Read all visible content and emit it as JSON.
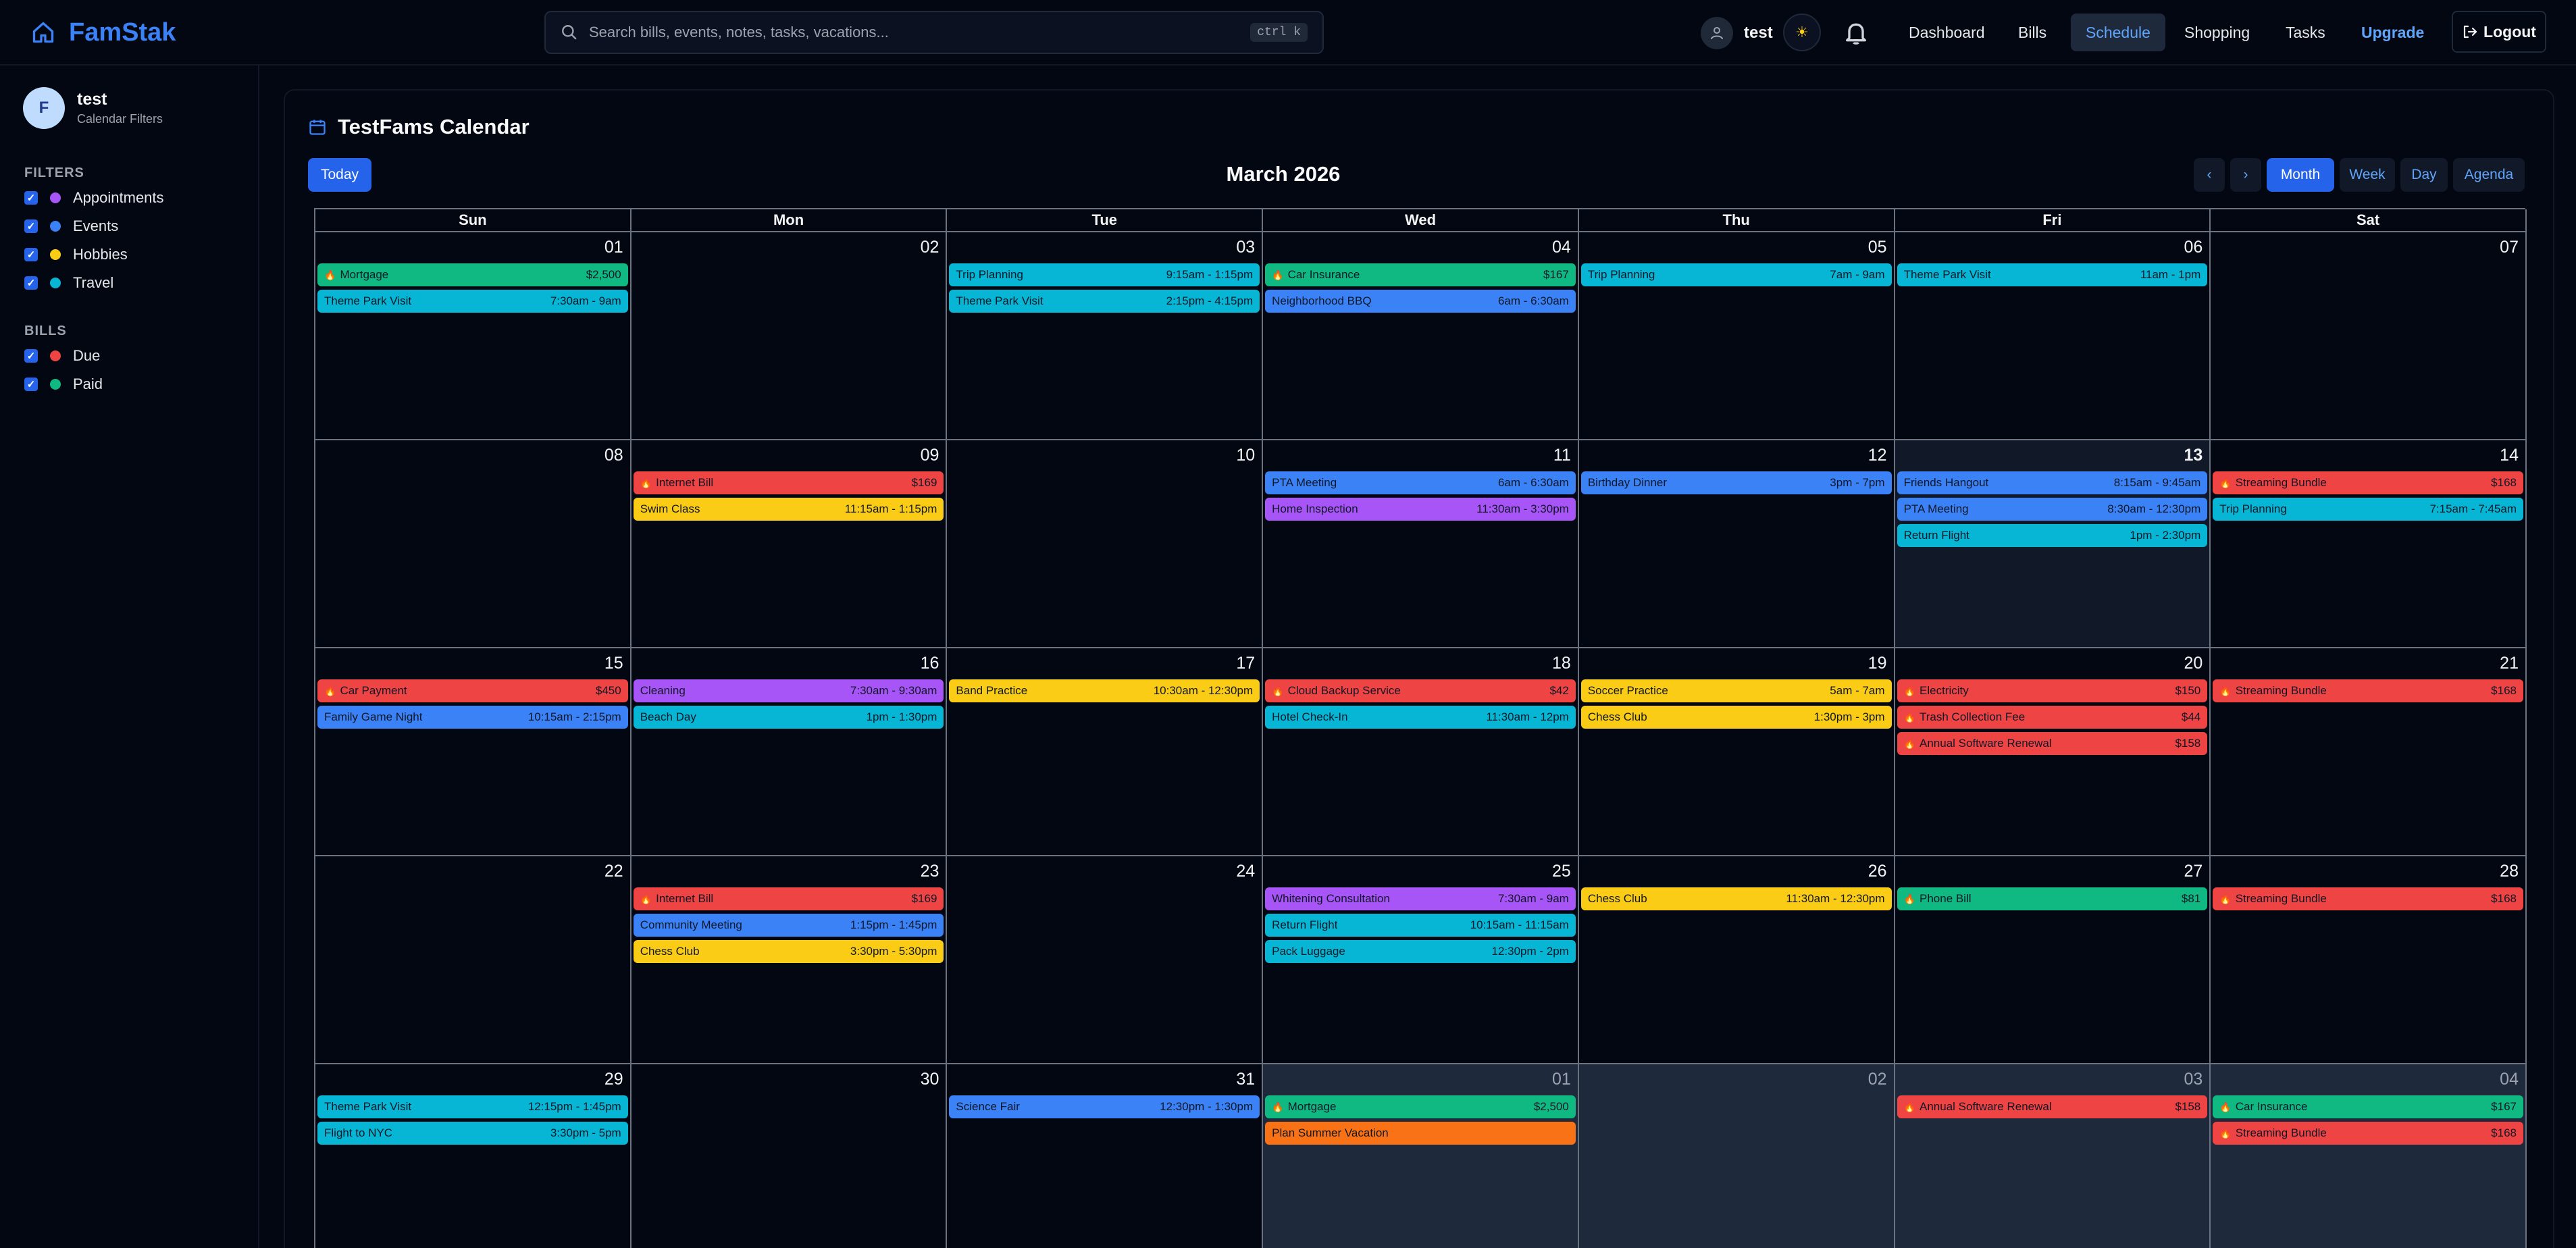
{
  "app": {
    "brand": "FamStak"
  },
  "colors": {
    "appointment": "#a855f7",
    "event": "#3b82f6",
    "hobby": "#facc15",
    "travel": "#06b6d4",
    "due": "#ef4444",
    "paid": "#10b981",
    "vacation": "#f97316"
  },
  "search": {
    "placeholder": "Search bills, events, notes, tasks, vacations...",
    "shortcut": "ctrl k",
    "value": ""
  },
  "user": {
    "name": "test"
  },
  "nav": {
    "items": [
      "Dashboard",
      "Bills",
      "Schedule",
      "Shopping",
      "Tasks"
    ],
    "active": "Schedule",
    "upgrade": "Upgrade",
    "logout": "Logout"
  },
  "sidebar": {
    "profile": {
      "initial": "F",
      "name": "test",
      "subtitle": "Calendar Filters"
    },
    "filters_title": "FILTERS",
    "filters": [
      {
        "label": "Appointments",
        "color": "#a855f7",
        "checked": true
      },
      {
        "label": "Events",
        "color": "#3b82f6",
        "checked": true
      },
      {
        "label": "Hobbies",
        "color": "#facc15",
        "checked": true
      },
      {
        "label": "Travel",
        "color": "#06b6d4",
        "checked": true
      }
    ],
    "bills_title": "BILLS",
    "bills": [
      {
        "label": "Due",
        "color": "#ef4444",
        "checked": true
      },
      {
        "label": "Paid",
        "color": "#10b981",
        "checked": true
      }
    ]
  },
  "calendar": {
    "title": "TestFams Calendar",
    "today_button": "Today",
    "month_label": "March 2026",
    "views": [
      "Month",
      "Week",
      "Day",
      "Agenda"
    ],
    "active_view": "Month",
    "weekdays": [
      "Sun",
      "Mon",
      "Tue",
      "Wed",
      "Thu",
      "Fri",
      "Sat"
    ],
    "weeks": [
      [
        {
          "day": "01",
          "events": [
            {
              "t": "Mortgage",
              "m": "$2,500",
              "c": "paid",
              "bill": true
            },
            {
              "t": "Theme Park Visit",
              "m": "7:30am - 9am",
              "c": "travel"
            }
          ]
        },
        {
          "day": "02",
          "events": []
        },
        {
          "day": "03",
          "events": [
            {
              "t": "Trip Planning",
              "m": "9:15am - 1:15pm",
              "c": "travel"
            },
            {
              "t": "Theme Park Visit",
              "m": "2:15pm - 4:15pm",
              "c": "travel"
            }
          ]
        },
        {
          "day": "04",
          "events": [
            {
              "t": "Car Insurance",
              "m": "$167",
              "c": "paid",
              "bill": true
            },
            {
              "t": "Neighborhood BBQ",
              "m": "6am - 6:30am",
              "c": "event"
            }
          ]
        },
        {
          "day": "05",
          "events": [
            {
              "t": "Trip Planning",
              "m": "7am - 9am",
              "c": "travel"
            }
          ]
        },
        {
          "day": "06",
          "events": [
            {
              "t": "Theme Park Visit",
              "m": "11am - 1pm",
              "c": "travel"
            }
          ]
        },
        {
          "day": "07",
          "events": []
        }
      ],
      [
        {
          "day": "08",
          "events": []
        },
        {
          "day": "09",
          "events": [
            {
              "t": "Internet Bill",
              "m": "$169",
              "c": "due",
              "bill": true
            },
            {
              "t": "Swim Class",
              "m": "11:15am - 1:15pm",
              "c": "hobby"
            }
          ]
        },
        {
          "day": "10",
          "events": []
        },
        {
          "day": "11",
          "events": [
            {
              "t": "PTA Meeting",
              "m": "6am - 6:30am",
              "c": "event"
            },
            {
              "t": "Home Inspection",
              "m": "11:30am - 3:30pm",
              "c": "appointment"
            }
          ]
        },
        {
          "day": "12",
          "events": [
            {
              "t": "Birthday Dinner",
              "m": "3pm - 7pm",
              "c": "event"
            }
          ]
        },
        {
          "day": "13",
          "today": true,
          "events": [
            {
              "t": "Friends Hangout",
              "m": "8:15am - 9:45am",
              "c": "event"
            },
            {
              "t": "PTA Meeting",
              "m": "8:30am - 12:30pm",
              "c": "event"
            },
            {
              "t": "Return Flight",
              "m": "1pm - 2:30pm",
              "c": "travel"
            }
          ]
        },
        {
          "day": "14",
          "events": [
            {
              "t": "Streaming Bundle",
              "m": "$168",
              "c": "due",
              "bill": true
            },
            {
              "t": "Trip Planning",
              "m": "7:15am - 7:45am",
              "c": "travel"
            }
          ]
        }
      ],
      [
        {
          "day": "15",
          "events": [
            {
              "t": "Car Payment",
              "m": "$450",
              "c": "due",
              "bill": true
            },
            {
              "t": "Family Game Night",
              "m": "10:15am - 2:15pm",
              "c": "event"
            }
          ]
        },
        {
          "day": "16",
          "events": [
            {
              "t": "Cleaning",
              "m": "7:30am - 9:30am",
              "c": "appointment"
            },
            {
              "t": "Beach Day",
              "m": "1pm - 1:30pm",
              "c": "travel"
            }
          ]
        },
        {
          "day": "17",
          "events": [
            {
              "t": "Band Practice",
              "m": "10:30am - 12:30pm",
              "c": "hobby"
            }
          ]
        },
        {
          "day": "18",
          "events": [
            {
              "t": "Cloud Backup Service",
              "m": "$42",
              "c": "due",
              "bill": true
            },
            {
              "t": "Hotel Check-In",
              "m": "11:30am - 12pm",
              "c": "travel"
            }
          ]
        },
        {
          "day": "19",
          "events": [
            {
              "t": "Soccer Practice",
              "m": "5am - 7am",
              "c": "hobby"
            },
            {
              "t": "Chess Club",
              "m": "1:30pm - 3pm",
              "c": "hobby"
            }
          ]
        },
        {
          "day": "20",
          "events": [
            {
              "t": "Electricity",
              "m": "$150",
              "c": "due",
              "bill": true
            },
            {
              "t": "Trash Collection Fee",
              "m": "$44",
              "c": "due",
              "bill": true
            },
            {
              "t": "Annual Software Renewal",
              "m": "$158",
              "c": "due",
              "bill": true
            }
          ]
        },
        {
          "day": "21",
          "events": [
            {
              "t": "Streaming Bundle",
              "m": "$168",
              "c": "due",
              "bill": true
            }
          ]
        }
      ],
      [
        {
          "day": "22",
          "events": []
        },
        {
          "day": "23",
          "events": [
            {
              "t": "Internet Bill",
              "m": "$169",
              "c": "due",
              "bill": true
            },
            {
              "t": "Community Meeting",
              "m": "1:15pm - 1:45pm",
              "c": "event"
            },
            {
              "t": "Chess Club",
              "m": "3:30pm - 5:30pm",
              "c": "hobby"
            }
          ]
        },
        {
          "day": "24",
          "events": []
        },
        {
          "day": "25",
          "events": [
            {
              "t": "Whitening Consultation",
              "m": "7:30am - 9am",
              "c": "appointment"
            },
            {
              "t": "Return Flight",
              "m": "10:15am - 11:15am",
              "c": "travel"
            },
            {
              "t": "Pack Luggage",
              "m": "12:30pm - 2pm",
              "c": "travel"
            }
          ]
        },
        {
          "day": "26",
          "events": [
            {
              "t": "Chess Club",
              "m": "11:30am - 12:30pm",
              "c": "hobby"
            }
          ]
        },
        {
          "day": "27",
          "events": [
            {
              "t": "Phone Bill",
              "m": "$81",
              "c": "paid",
              "bill": true
            }
          ]
        },
        {
          "day": "28",
          "events": [
            {
              "t": "Streaming Bundle",
              "m": "$168",
              "c": "due",
              "bill": true
            }
          ]
        }
      ],
      [
        {
          "day": "29",
          "events": [
            {
              "t": "Theme Park Visit",
              "m": "12:15pm - 1:45pm",
              "c": "travel"
            },
            {
              "t": "Flight to NYC",
              "m": "3:30pm - 5pm",
              "c": "travel"
            }
          ]
        },
        {
          "day": "30",
          "events": []
        },
        {
          "day": "31",
          "events": [
            {
              "t": "Science Fair",
              "m": "12:30pm - 1:30pm",
              "c": "event"
            }
          ]
        },
        {
          "day": "01",
          "other": true,
          "events": [
            {
              "t": "Mortgage",
              "m": "$2,500",
              "c": "paid",
              "bill": true
            },
            {
              "t": "Plan Summer Vacation",
              "m": "",
              "c": "vacation"
            }
          ]
        },
        {
          "day": "02",
          "other": true,
          "events": []
        },
        {
          "day": "03",
          "other": true,
          "events": [
            {
              "t": "Annual Software Renewal",
              "m": "$158",
              "c": "due",
              "bill": true
            }
          ]
        },
        {
          "day": "04",
          "other": true,
          "events": [
            {
              "t": "Car Insurance",
              "m": "$167",
              "c": "paid",
              "bill": true
            },
            {
              "t": "Streaming Bundle",
              "m": "$168",
              "c": "due",
              "bill": true
            }
          ]
        }
      ]
    ]
  }
}
